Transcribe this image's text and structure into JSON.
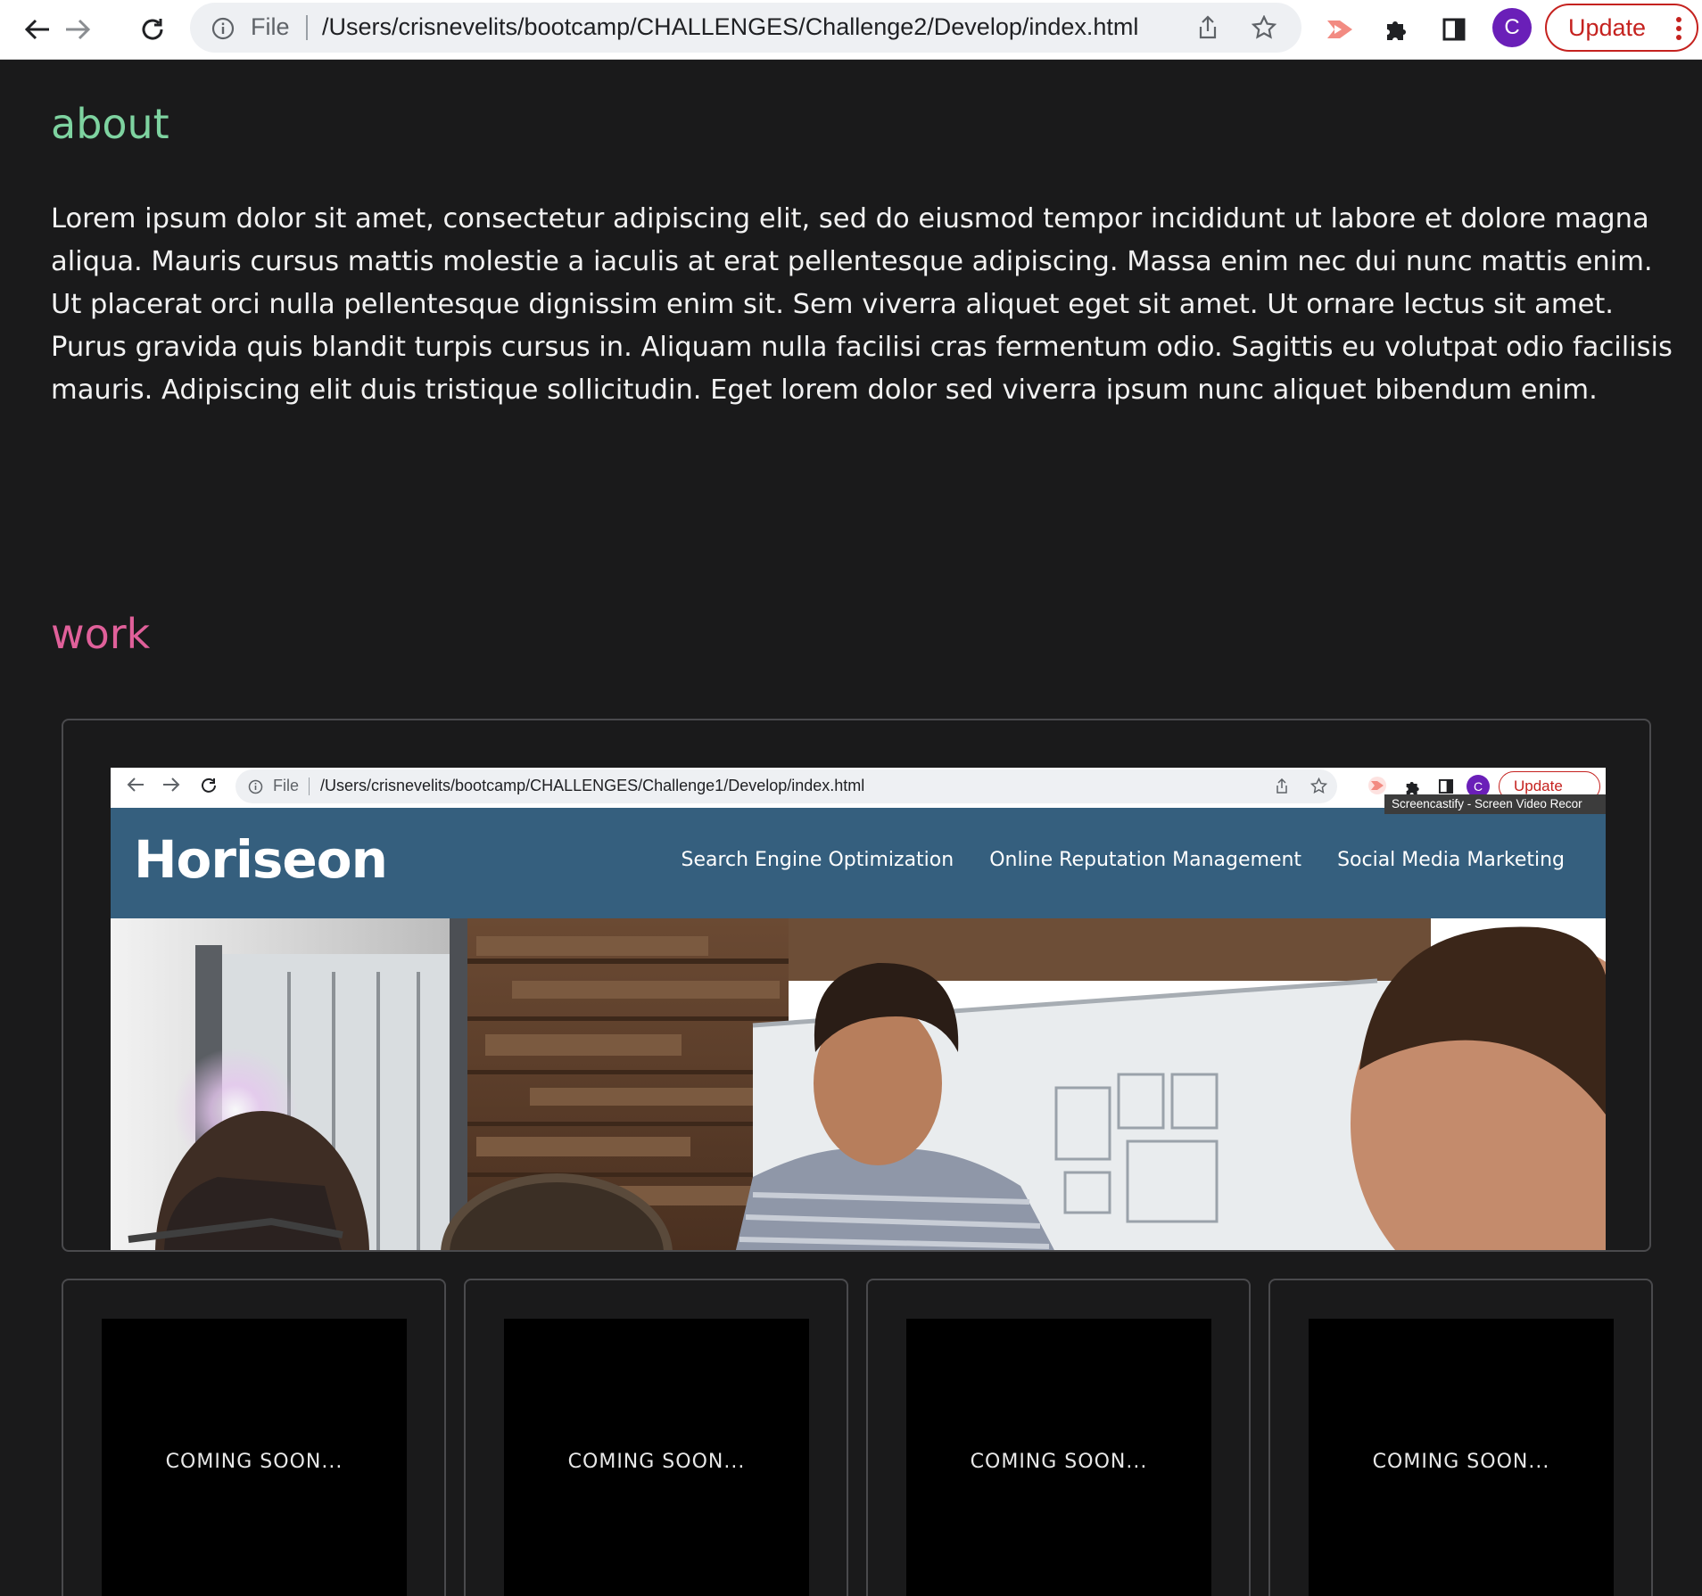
{
  "browser": {
    "file_label": "File",
    "url": "/Users/crisnevelits/bootcamp/CHALLENGES/Challenge2/Develop/index.html",
    "avatar_initial": "C",
    "update_label": "Update"
  },
  "about": {
    "title": "about",
    "title_color": "#7ed3a0",
    "body": "Lorem ipsum dolor sit amet, consectetur adipiscing elit, sed do eiusmod tempor incididunt ut labore et dolore magna aliqua. Mauris cursus mattis molestie a iaculis at erat pellentesque adipiscing. Massa enim nec dui nunc mattis enim. Ut placerat orci nulla pellentesque dignissim enim sit. Sem viverra aliquet eget sit amet. Ut ornare lectus sit amet. Purus gravida quis blandit turpis cursus in. Aliquam nulla facilisi cras fermentum odio. Sagittis eu volutpat odio facilisis mauris. Adipiscing elit duis tristique sollicitudin. Eget lorem dolor sed viverra ipsum nunc aliquet bibendum enim."
  },
  "work": {
    "title": "work",
    "title_color": "#e0609a",
    "featured": {
      "inner_browser": {
        "file_label": "File",
        "url": "/Users/crisnevelits/bootcamp/CHALLENGES/Challenge1/Develop/index.html",
        "avatar_initial": "C",
        "update_label": "Update",
        "tooltip": "Screencastify - Screen Video Recor"
      },
      "site": {
        "logo": "Horiseon",
        "nav": [
          "Search Engine Optimization",
          "Online Reputation Management",
          "Social Media Marketing"
        ],
        "header_color": "#355f7e"
      }
    },
    "cards": [
      {
        "label": "COMING SOON..."
      },
      {
        "label": "COMING SOON..."
      },
      {
        "label": "COMING SOON..."
      },
      {
        "label": "COMING SOON..."
      }
    ]
  }
}
